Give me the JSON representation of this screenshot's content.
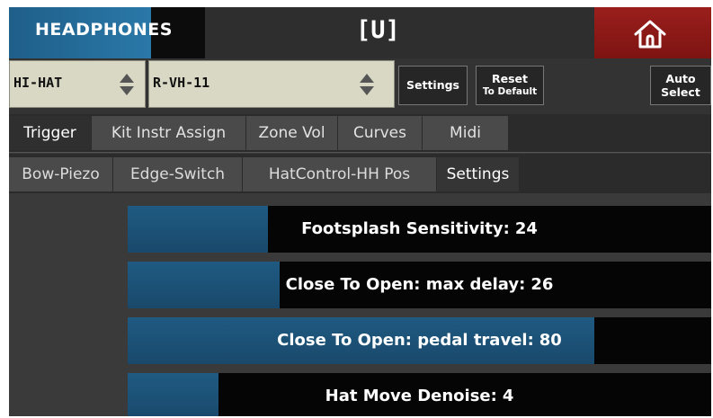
{
  "header": {
    "output_label": "HEADPHONES",
    "title": "[U]",
    "home_icon": "home-icon"
  },
  "selectors": {
    "instrument": {
      "value": "HI-HAT"
    },
    "trigger_model": {
      "value": "R-VH-11"
    },
    "settings_label": "Settings",
    "reset_label_line1": "Reset",
    "reset_label_line2": "To Default",
    "auto_label_line1": "Auto",
    "auto_label_line2": "Select"
  },
  "tabs_main": [
    {
      "label": "Trigger",
      "active": true
    },
    {
      "label": "Kit Instr Assign",
      "active": false
    },
    {
      "label": "Zone Vol",
      "active": false
    },
    {
      "label": "Curves",
      "active": false
    },
    {
      "label": "Midi",
      "active": false
    }
  ],
  "tabs_sub": [
    {
      "label": "Bow-Piezo",
      "active": false
    },
    {
      "label": "Edge-Switch",
      "active": false
    },
    {
      "label": "HatControl-HH Pos",
      "active": false
    },
    {
      "label": "Settings",
      "active": true
    }
  ],
  "sliders": [
    {
      "label": "Footsplash Sensitivity:",
      "value": "24",
      "fill_percent": 24
    },
    {
      "label": "Close To Open: max delay:",
      "value": "26",
      "fill_percent": 26
    },
    {
      "label": "Close To Open: pedal travel:",
      "value": "80",
      "fill_percent": 80
    },
    {
      "label": "Hat Move Denoise:",
      "value": "4",
      "fill_percent": 15.5
    }
  ],
  "colors": {
    "accent_blue": "#2a78a8",
    "home_red": "#9a1f1c",
    "selector_bg": "#d9d8c4"
  }
}
